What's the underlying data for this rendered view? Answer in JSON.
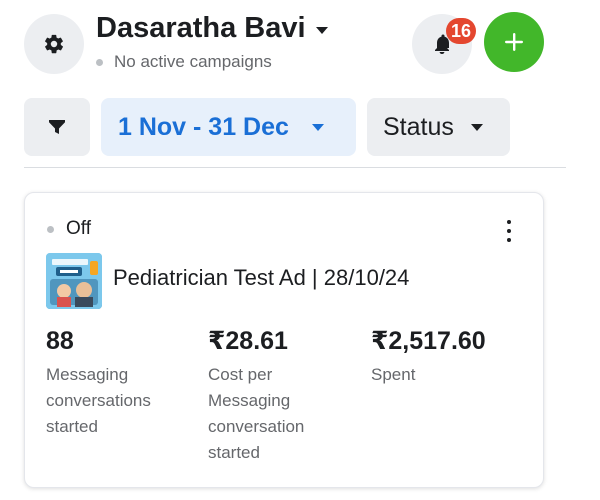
{
  "header": {
    "account_name": "Dasaratha Bavi",
    "account_status": "No active campaigns",
    "notification_count": "16"
  },
  "filters": {
    "date_range": "1 Nov - 31 Dec",
    "status": "Status"
  },
  "campaign": {
    "status": "Off",
    "ad_name": "Pediatrician Test Ad | 28/10/24",
    "metrics": [
      {
        "value": "88",
        "label": "Messaging conversations started"
      },
      {
        "value": "₹28.61",
        "label": "Cost per Messaging conversation started"
      },
      {
        "value": "₹2,517.60",
        "label": "Spent"
      }
    ]
  },
  "icons": {
    "settings": "gear-icon",
    "notifications": "bell-icon",
    "add": "plus-icon",
    "filter": "funnel-icon",
    "more": "more-vertical-icon"
  },
  "colors": {
    "accent_blue": "#1a6fd6",
    "date_chip_bg": "#e7f0fb",
    "add_green": "#42b72a",
    "badge_red": "#e4472f",
    "chip_gray": "#eceef1"
  }
}
